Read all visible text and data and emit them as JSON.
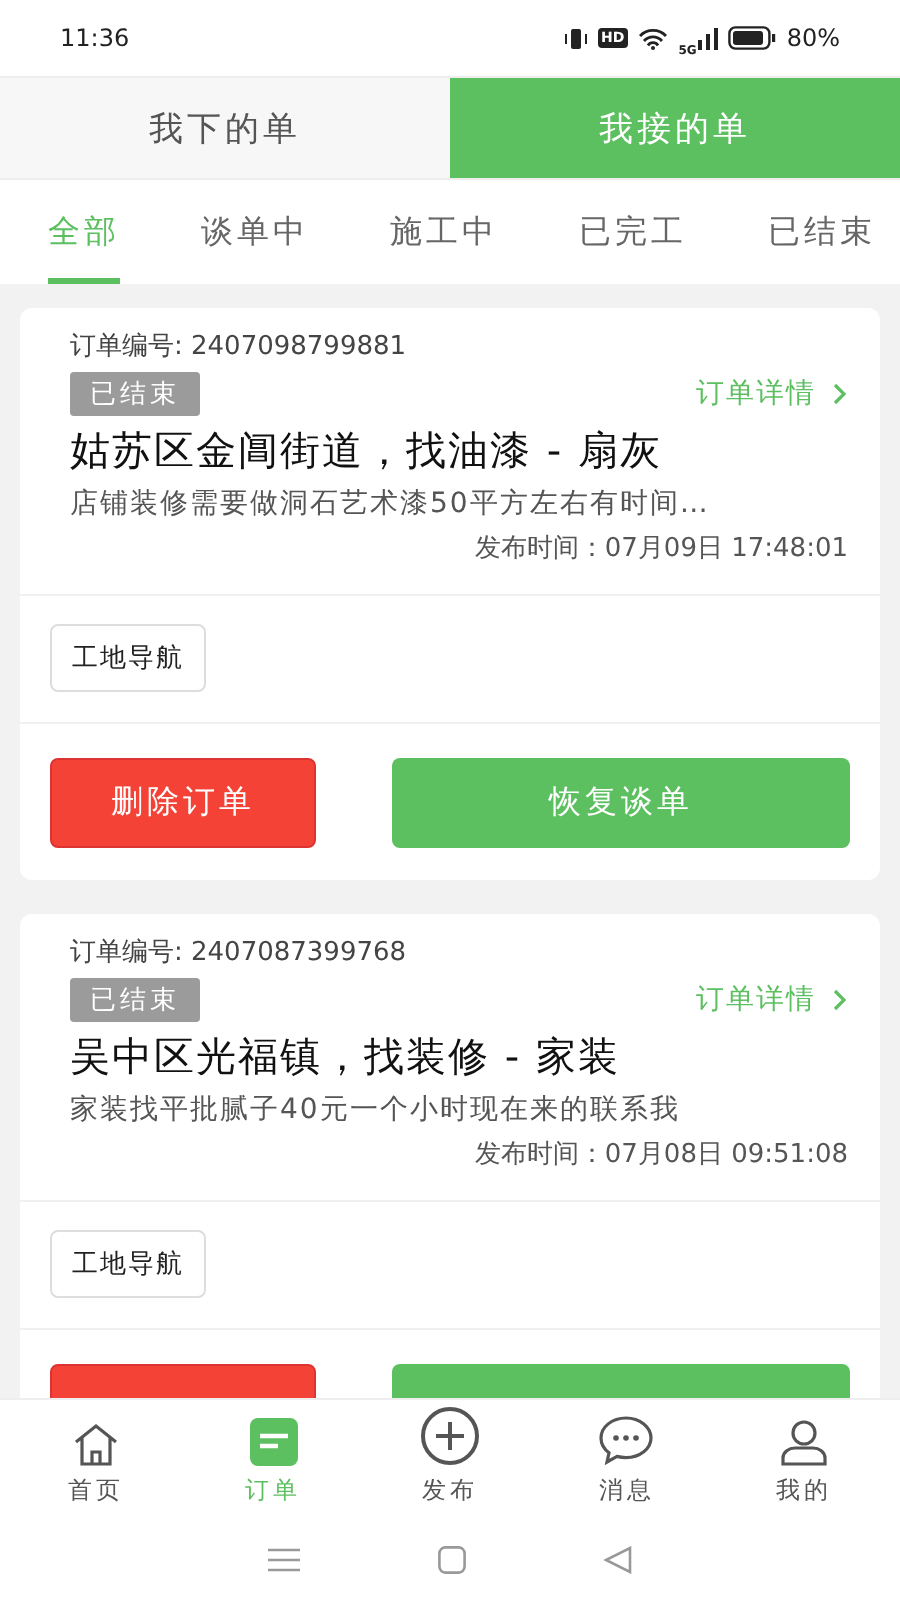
{
  "status_bar": {
    "time": "11:36",
    "hd": "HD",
    "network": "5G",
    "battery": "80%"
  },
  "top_tabs": [
    {
      "label": "我下的单",
      "selected": false
    },
    {
      "label": "我接的单",
      "selected": true
    }
  ],
  "filter_tabs": [
    {
      "label": "全部",
      "selected": true
    },
    {
      "label": "谈单中",
      "selected": false
    },
    {
      "label": "施工中",
      "selected": false
    },
    {
      "label": "已完工",
      "selected": false
    },
    {
      "label": "已结束",
      "selected": false
    }
  ],
  "orders": [
    {
      "order_no": "订单编号: 2407098799881",
      "status": "已结束",
      "detail_link": "订单详情",
      "title": "姑苏区金阊街道，找油漆 - 扇灰",
      "description": "店铺装修需要做洞石艺术漆50平方左右有时间…",
      "published": "发布时间：07月09日  17:48:01",
      "nav_button": "工地导航",
      "buttons": [
        {
          "kind": "delete",
          "label": "删除订单"
        },
        {
          "kind": "restore",
          "label": "恢复谈单"
        }
      ]
    },
    {
      "order_no": "订单编号: 2407087399768",
      "status": "已结束",
      "detail_link": "订单详情",
      "title": "吴中区光福镇，找装修 - 家装",
      "description": "家装找平批腻子40元一个小时现在来的联系我",
      "published": "发布时间：07月08日  09:51:08",
      "nav_button": "工地导航",
      "buttons": [
        {
          "kind": "delete"
        },
        {
          "kind": "restore"
        }
      ]
    }
  ],
  "bottom_nav": [
    {
      "kind": "home",
      "label": "首页",
      "selected": false
    },
    {
      "kind": "orders",
      "label": "订单",
      "selected": true
    },
    {
      "kind": "add",
      "label": "发布",
      "selected": false
    },
    {
      "kind": "chat",
      "label": "消息",
      "selected": false
    },
    {
      "kind": "user",
      "label": "我的",
      "selected": false
    }
  ]
}
